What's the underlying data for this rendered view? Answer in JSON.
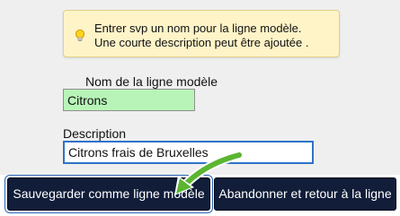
{
  "info": {
    "icon": "lightbulb-icon",
    "line1": "Entrer svp un nom pour la ligne modèle.",
    "line2": "Une courte description peut être ajoutée ."
  },
  "form": {
    "name_label": "Nom de la ligne modèle",
    "name_value": "Citrons",
    "description_label": "Description",
    "description_value": "Citrons frais de Bruxelles"
  },
  "buttons": {
    "save": "Sauvegarder comme ligne modèle",
    "abandon": "Abandonner et retour à la ligne"
  },
  "annotation": {
    "icon": "green-arrow-icon",
    "color": "#5bb531"
  }
}
